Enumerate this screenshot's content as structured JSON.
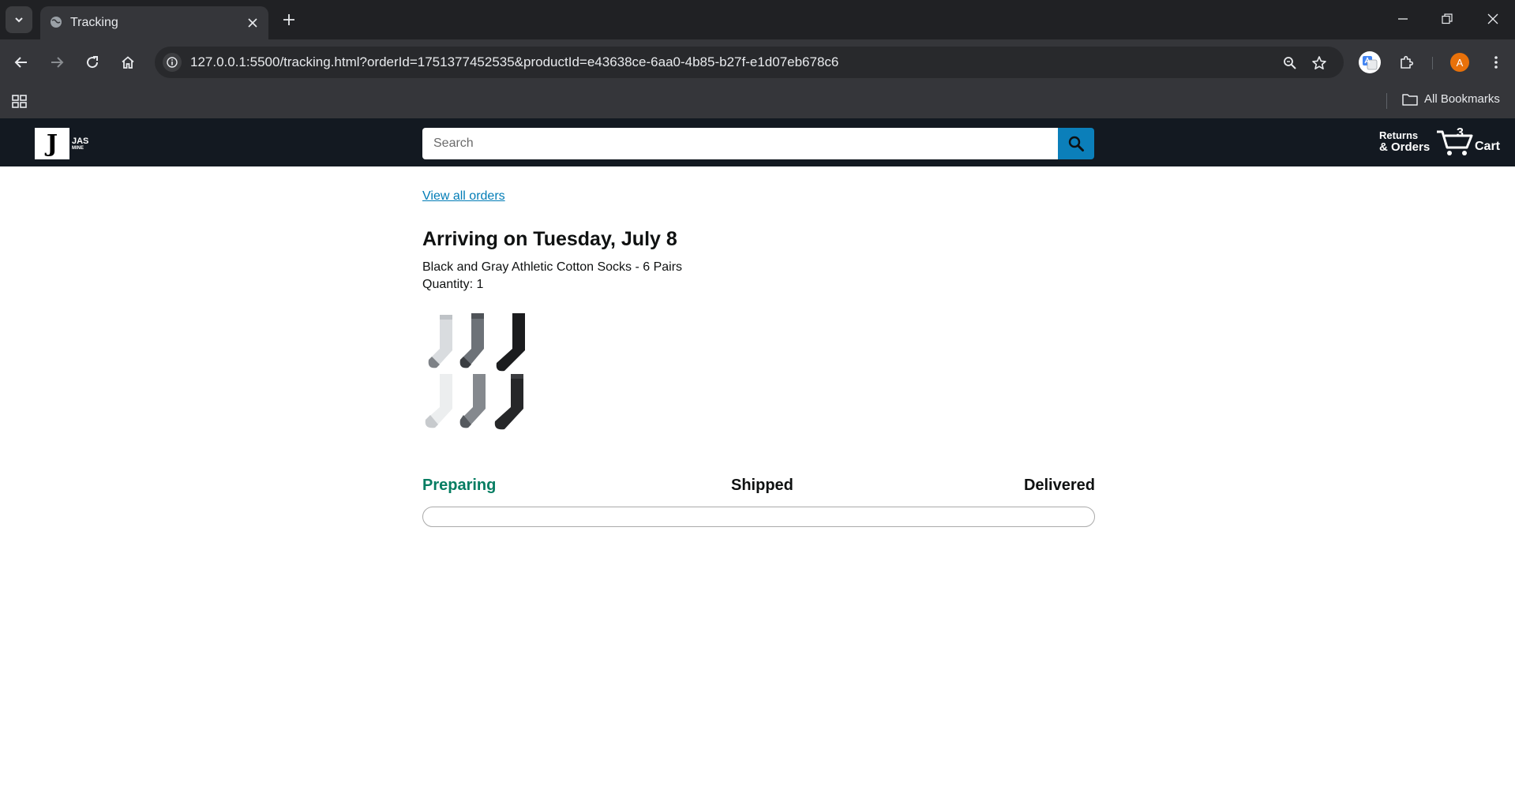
{
  "browser": {
    "tab_title": "Tracking",
    "url": "127.0.0.1:5500/tracking.html?orderId=1751377452535&productId=e43638ce-6aa0-4b85-b27f-e1d07eb678c6",
    "profile_initial": "A",
    "bookmarks_label": "All Bookmarks"
  },
  "header": {
    "logo_letter": "J",
    "logo_line1": "JAS",
    "logo_line2": "MINE",
    "search_placeholder": "Search",
    "returns_line1": "Returns",
    "returns_line2": "& Orders",
    "cart_count": "3",
    "cart_label": "Cart"
  },
  "tracking": {
    "back_link": "View all orders",
    "delivery_date": "Arriving on Tuesday, July 8",
    "product_name": "Black and Gray Athletic Cotton Socks - 6 Pairs",
    "quantity_text": "Quantity: 1",
    "image_alt": "socks product image",
    "stages": [
      "Preparing",
      "Shipped",
      "Delivered"
    ],
    "current_stage": "Preparing",
    "progress_percent": 0
  },
  "colors": {
    "header_bg": "#131921",
    "search_button": "#0b7fba",
    "link": "#017cb6",
    "active_stage": "#067d62"
  }
}
